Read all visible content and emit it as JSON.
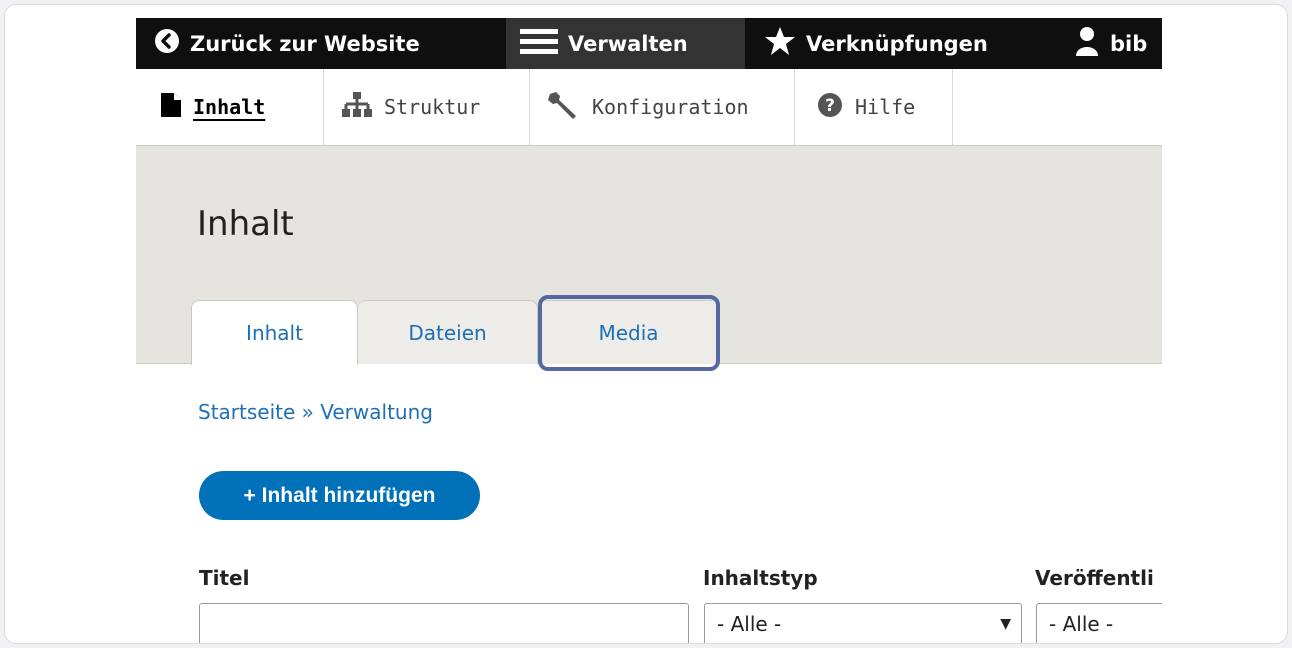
{
  "toolbar": {
    "back": "Zurück zur Website",
    "manage": "Verwalten",
    "shortcuts": "Verknüpfungen",
    "user": "bib"
  },
  "tray": {
    "content": "Inhalt",
    "structure": "Struktur",
    "configuration": "Konfiguration",
    "help": "Hilfe"
  },
  "page": {
    "title": "Inhalt"
  },
  "tabs": [
    "Inhalt",
    "Dateien",
    "Media"
  ],
  "breadcrumb": "Startseite » Verwaltung",
  "add_button": "+ Inhalt hinzufügen",
  "filters": {
    "title_label": "Titel",
    "title_value": "",
    "type_label": "Inhaltstyp",
    "type_value": "- Alle -",
    "status_label": "Veröffentli",
    "status_value": "- Alle -"
  },
  "colors": {
    "toolbar_bg": "#0f0f0f",
    "link": "#1f6fb5",
    "button": "#0071b8",
    "highlight": "#5568a0"
  }
}
